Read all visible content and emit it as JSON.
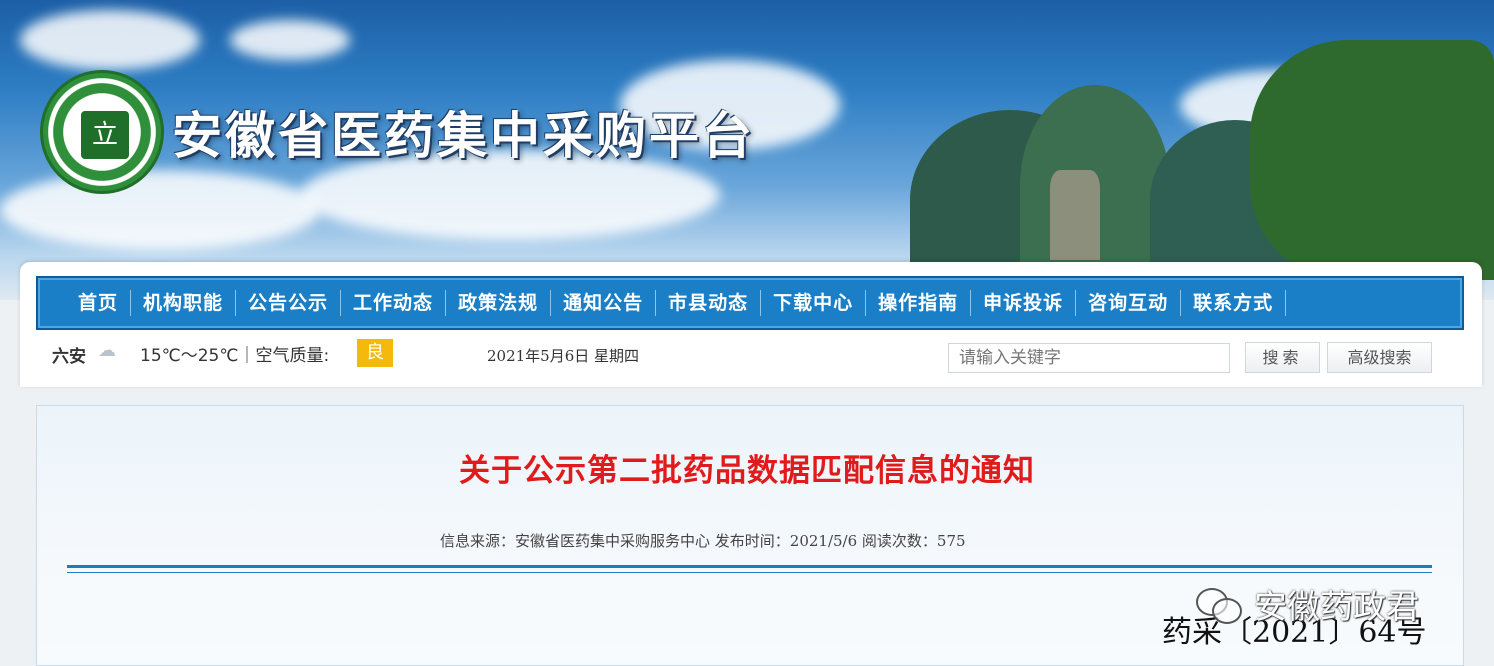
{
  "header": {
    "site_title": "安徽省医药集中采购平台",
    "logo_glyph": "立"
  },
  "nav": {
    "items": [
      "首页",
      "机构职能",
      "公告公示",
      "工作动态",
      "政策法规",
      "通知公告",
      "市县动态",
      "下载中心",
      "操作指南",
      "申诉投诉",
      "咨询互动",
      "联系方式"
    ]
  },
  "info_bar": {
    "city": "六安",
    "weather_icon": "cloud-icon",
    "temperature_text": "15℃～25℃｜空气质量:",
    "air_quality": "良",
    "date_text": "2021年5月6日  星期四"
  },
  "search": {
    "placeholder": "请输入关键字",
    "search_label": "搜索",
    "advanced_label": "高级搜索"
  },
  "article": {
    "title": "关于公示第二批药品数据匹配信息的通知",
    "meta_text": "信息来源：安徽省医药集中采购服务中心 发布时间：2021/5/6 阅读次数：575",
    "doc_number": "药采〔2021〕64号"
  },
  "watermark": {
    "text": "安徽药政君",
    "icon": "wechat-icon"
  },
  "colors": {
    "nav_bg": "#1a7fc6",
    "title_red": "#e01b1b",
    "badge_yellow": "#f5b90e",
    "divider_blue": "#1d7bbf"
  }
}
